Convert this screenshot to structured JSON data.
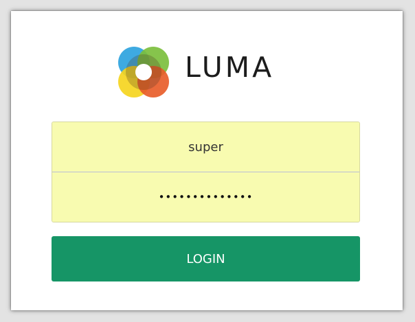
{
  "brand": {
    "name": "LUMA",
    "logo_icon": "luma-flower-logo-icon",
    "logo_colors": [
      "#2ea3de",
      "#7cbf3d",
      "#f5d520",
      "#e85d2a"
    ]
  },
  "login_form": {
    "username_value": "super",
    "password_value": "••••••••••••••",
    "login_label": "LOGIN"
  },
  "colors": {
    "field_background": "#f8fbb0",
    "button_background": "#169566",
    "button_text": "#ffffff"
  }
}
